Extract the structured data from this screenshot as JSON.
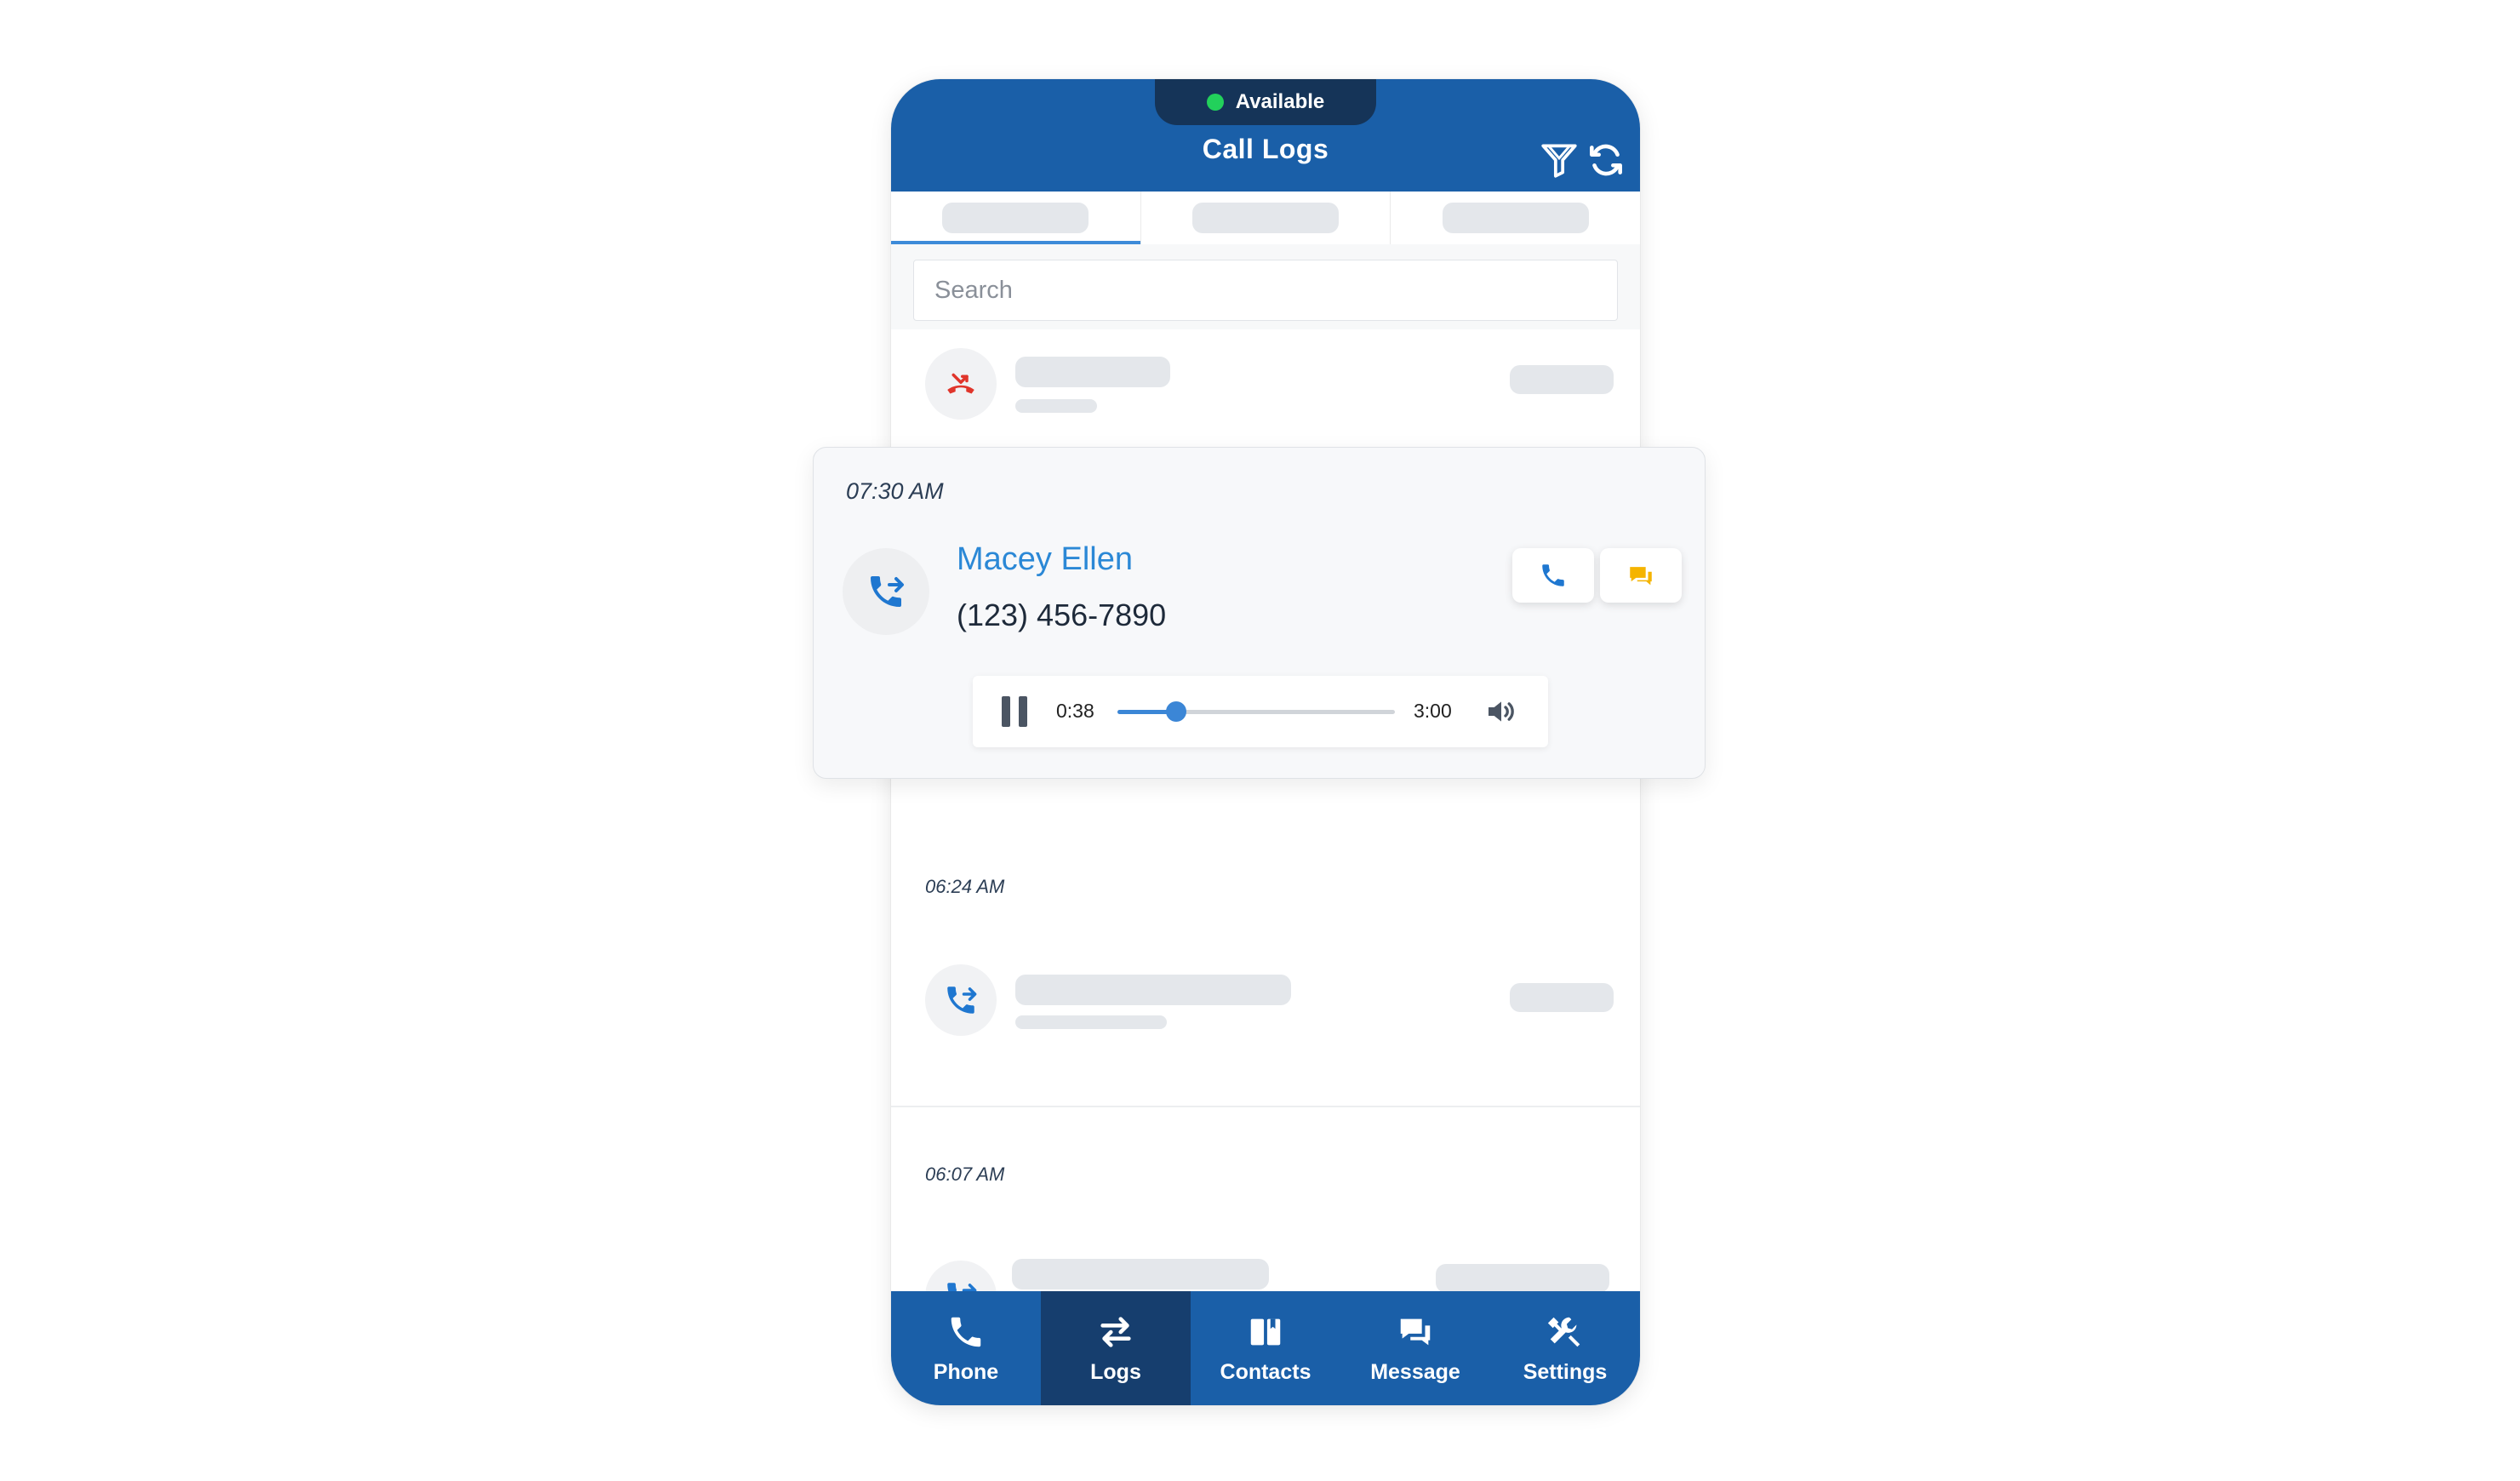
{
  "header": {
    "status": "Available",
    "status_color": "#22d15b",
    "title": "Call Logs",
    "icons": [
      "filter-icon",
      "refresh-icon"
    ]
  },
  "search": {
    "placeholder": "Search"
  },
  "expanded_call": {
    "time": "07:30 AM",
    "name": "Macey Ellen",
    "phone": "(123) 456-7890",
    "direction_icon": "outgoing-call-icon",
    "actions": [
      "phone-icon",
      "message-icon"
    ],
    "player": {
      "current": "0:38",
      "total": "3:00",
      "progress": 0.211
    }
  },
  "call_list": [
    {
      "time": "06:24 AM",
      "direction_icon": "outgoing-call-icon"
    },
    {
      "time": "06:07 AM",
      "direction_icon": "outgoing-call-icon"
    }
  ],
  "first_row": {
    "direction_icon": "missed-call-icon",
    "color": "#e0352b"
  },
  "bottom_nav": [
    {
      "label": "Phone",
      "icon": "phone-icon"
    },
    {
      "label": "Logs",
      "icon": "swap-arrows-icon",
      "active": true
    },
    {
      "label": "Contacts",
      "icon": "contacts-book-icon"
    },
    {
      "label": "Message",
      "icon": "chat-bubbles-icon"
    },
    {
      "label": "Settings",
      "icon": "tools-icon"
    }
  ],
  "colors": {
    "brand": "#1a5fa8",
    "nav_active": "#163e6e",
    "accent": "#2b88d6",
    "message_accent": "#f5b400"
  }
}
